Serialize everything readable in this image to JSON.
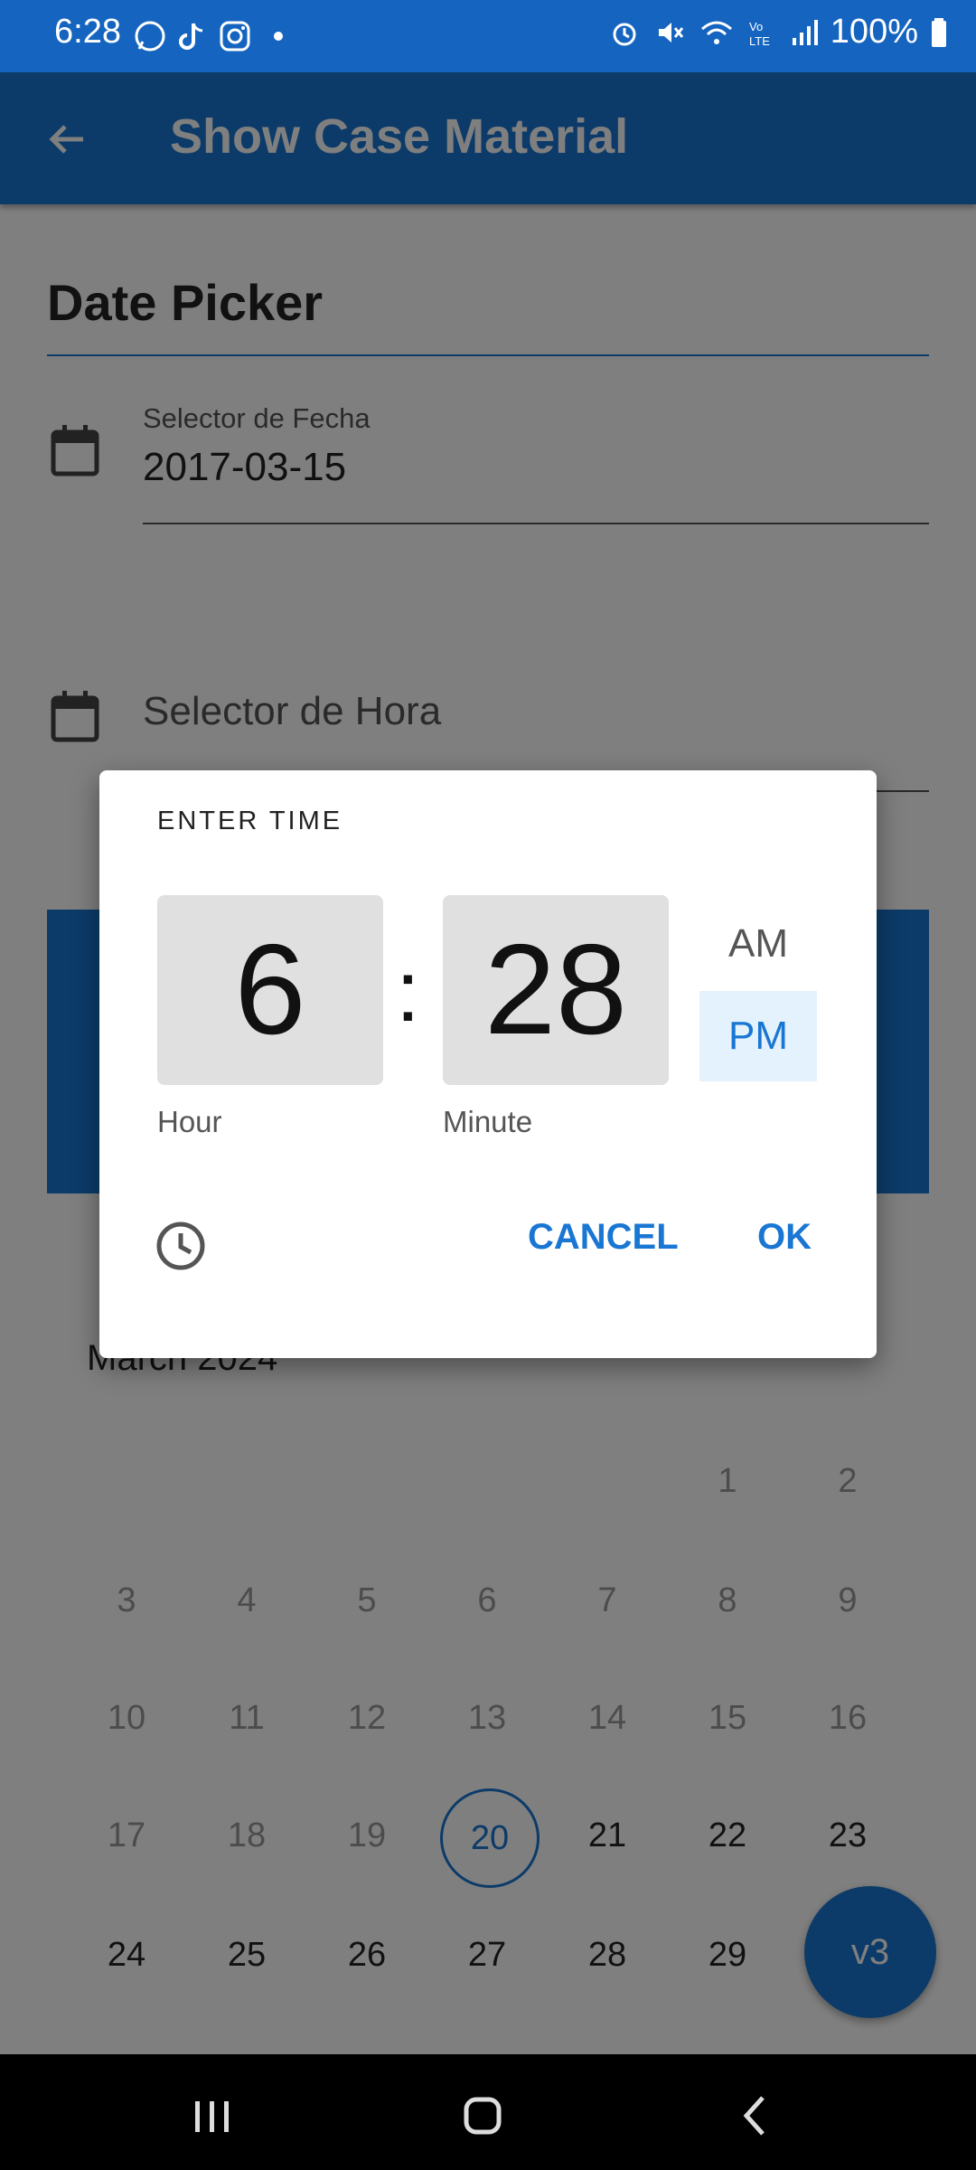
{
  "status_bar": {
    "time": "6:28",
    "battery": "100%",
    "icons": [
      "whatsapp-icon",
      "tiktok-icon",
      "instagram-icon",
      "dot-icon",
      "alarm-icon",
      "mute-icon",
      "wifi-icon",
      "volte-icon",
      "signal-icon",
      "battery-icon"
    ]
  },
  "app_bar": {
    "title": "Show Case Material",
    "back_icon": "arrow-back-icon"
  },
  "page": {
    "section_title": "Date Picker",
    "date_field": {
      "label": "Selector de Fecha",
      "value": "2017-03-15"
    },
    "time_field": {
      "label": "Selector de Hora"
    },
    "calendar": {
      "month": "March 2024",
      "rows": [
        [
          "",
          "",
          "",
          "",
          "",
          "1",
          "2"
        ],
        [
          "3",
          "4",
          "5",
          "6",
          "7",
          "8",
          "9"
        ],
        [
          "10",
          "11",
          "12",
          "13",
          "14",
          "15",
          "16"
        ],
        [
          "17",
          "18",
          "19",
          "20",
          "21",
          "22",
          "23"
        ],
        [
          "24",
          "25",
          "26",
          "27",
          "28",
          "29",
          ""
        ]
      ],
      "selected": "20"
    },
    "fab_label": "v3"
  },
  "dialog": {
    "title": "ENTER TIME",
    "hour": "6",
    "separator": ":",
    "minute": "28",
    "hour_label": "Hour",
    "minute_label": "Minute",
    "am": "AM",
    "pm": "PM",
    "selected_period": "PM",
    "cancel": "CANCEL",
    "ok": "OK"
  },
  "colors": {
    "primary": "#1976d2",
    "status_bar": "#1565c0",
    "scrim": "rgba(0,0,0,0.5)"
  }
}
